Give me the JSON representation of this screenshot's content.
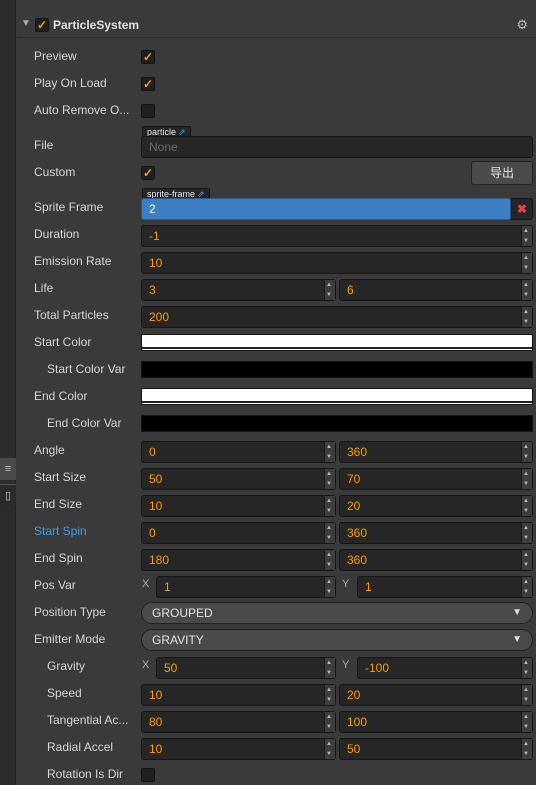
{
  "component": {
    "title": "ParticleSystem",
    "enabled": true
  },
  "preview": {
    "label": "Preview",
    "checked": true
  },
  "play_on_load": {
    "label": "Play On Load",
    "checked": true
  },
  "auto_remove": {
    "label": "Auto Remove O...",
    "checked": false
  },
  "file": {
    "label": "File",
    "tag": "particle",
    "value": "None"
  },
  "custom": {
    "label": "Custom",
    "checked": true,
    "export_button": "导出"
  },
  "sprite_frame": {
    "label": "Sprite Frame",
    "tag": "sprite-frame",
    "value": "2"
  },
  "duration": {
    "label": "Duration",
    "value": "-1"
  },
  "emission_rate": {
    "label": "Emission Rate",
    "value": "10"
  },
  "life": {
    "label": "Life",
    "value": "3",
    "var": "6"
  },
  "total_particles": {
    "label": "Total Particles",
    "value": "200"
  },
  "start_color": {
    "label": "Start Color",
    "color": "#ffffff"
  },
  "start_color_var": {
    "label": "Start Color Var",
    "color": "#000000"
  },
  "end_color": {
    "label": "End Color",
    "color": "#ffffff"
  },
  "end_color_var": {
    "label": "End Color Var",
    "color": "#000000"
  },
  "angle": {
    "label": "Angle",
    "value": "0",
    "var": "360"
  },
  "start_size": {
    "label": "Start Size",
    "value": "50",
    "var": "70"
  },
  "end_size": {
    "label": "End Size",
    "value": "10",
    "var": "20"
  },
  "start_spin": {
    "label": "Start Spin",
    "value": "0",
    "var": "360"
  },
  "end_spin": {
    "label": "End Spin",
    "value": "180",
    "var": "360"
  },
  "pos_var": {
    "label": "Pos Var",
    "x_label": "X",
    "x": "1",
    "y_label": "Y",
    "y": "1"
  },
  "position_type": {
    "label": "Position Type",
    "value": "GROUPED"
  },
  "emitter_mode": {
    "label": "Emitter Mode",
    "value": "GRAVITY"
  },
  "gravity": {
    "label": "Gravity",
    "x_label": "X",
    "x": "50",
    "y_label": "Y",
    "y": "-100"
  },
  "speed": {
    "label": "Speed",
    "value": "10",
    "var": "20"
  },
  "tangential_accel": {
    "label": "Tangential Ac...",
    "value": "80",
    "var": "100"
  },
  "radial_accel": {
    "label": "Radial Accel",
    "value": "10",
    "var": "50"
  },
  "rotation_is_dir": {
    "label": "Rotation Is Dir",
    "checked": false
  },
  "colors": {
    "accent": "#fd9d00",
    "selection": "#3b80c4",
    "link": "#3aa0e8"
  }
}
